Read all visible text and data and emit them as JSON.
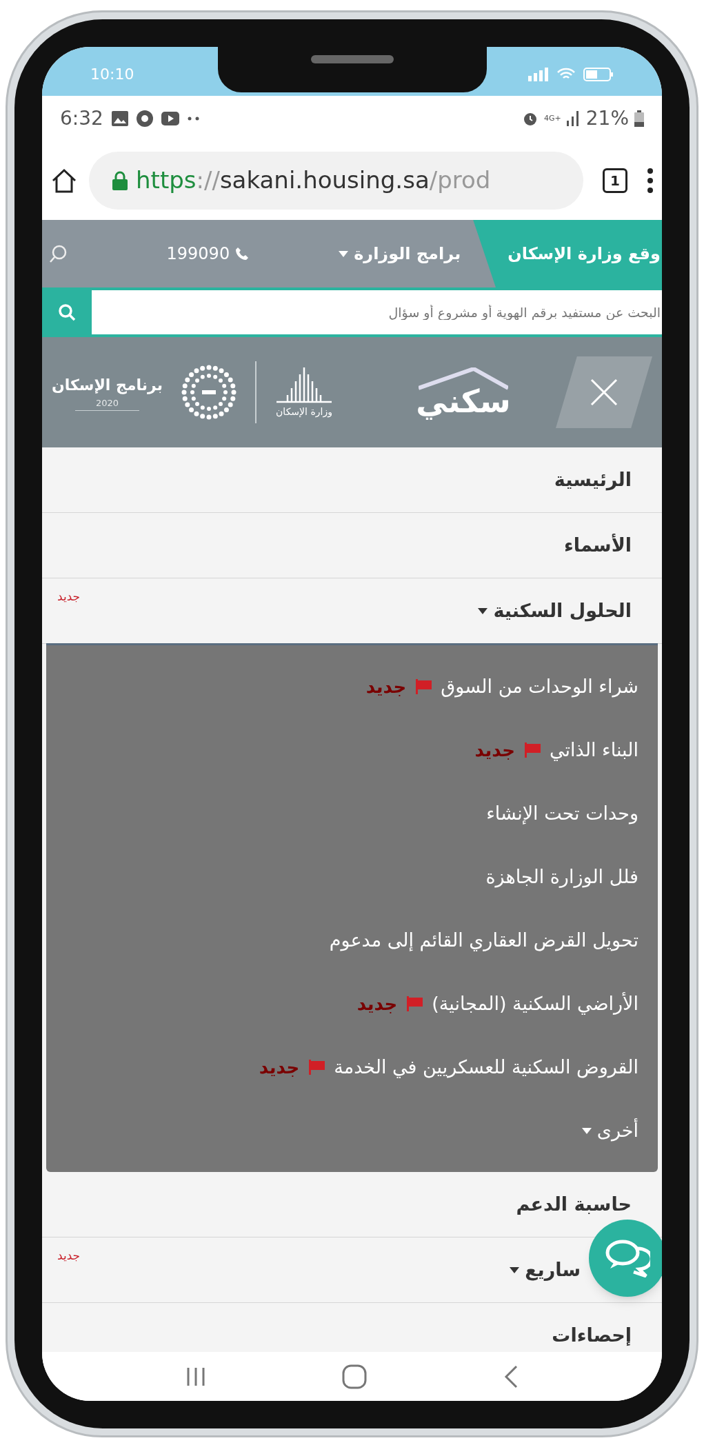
{
  "device_status": {
    "time": "10:10"
  },
  "status_bar": {
    "time": "6:32",
    "network": "4G+",
    "battery": "21%"
  },
  "browser": {
    "url": {
      "scheme": "https",
      "separator": "://",
      "host": "sakani.housing.sa",
      "path": "/prod"
    },
    "tab_count": "1"
  },
  "top_nav": {
    "site_link": "وقع وزارة الإسكان",
    "programs": "برامج الوزارة",
    "phone": "199090"
  },
  "search": {
    "placeholder": "البحث عن مستفيد برقم الهوية أو مشروع أو سؤال"
  },
  "logos": {
    "sakani": "سكني",
    "ministry": "وزارة الإسكان",
    "program": "برنامج الإسكان",
    "program_year": "2020"
  },
  "menu": [
    {
      "label": "الرئيسية",
      "kind": "link"
    },
    {
      "label": "الأسماء",
      "kind": "link"
    },
    {
      "label": "الحلول السكنية",
      "kind": "dropdown",
      "badge": "جديد",
      "children": [
        {
          "label": "شراء الوحدات من السوق",
          "kind": "link",
          "badge": "جديد"
        },
        {
          "label": "البناء الذاتي",
          "kind": "link",
          "badge": "جديد"
        },
        {
          "label": "وحدات تحت الإنشاء",
          "kind": "link"
        },
        {
          "label": "فلل الوزارة الجاهزة",
          "kind": "link"
        },
        {
          "label": "تحويل القرض العقاري القائم إلى مدعوم",
          "kind": "link"
        },
        {
          "label": "الأراضي السكنية (المجانية)",
          "kind": "link",
          "badge": "جديد"
        },
        {
          "label": "القروض السكنية للعسكريين في الخدمة",
          "kind": "link",
          "badge": "جديد"
        },
        {
          "label": "أخرى",
          "kind": "dropdown"
        }
      ]
    },
    {
      "label": "حاسبة الدعم",
      "kind": "link"
    },
    {
      "label": "ساريع",
      "kind": "dropdown",
      "badge": "جديد"
    },
    {
      "label": "إحصاءات",
      "kind": "link"
    }
  ]
}
